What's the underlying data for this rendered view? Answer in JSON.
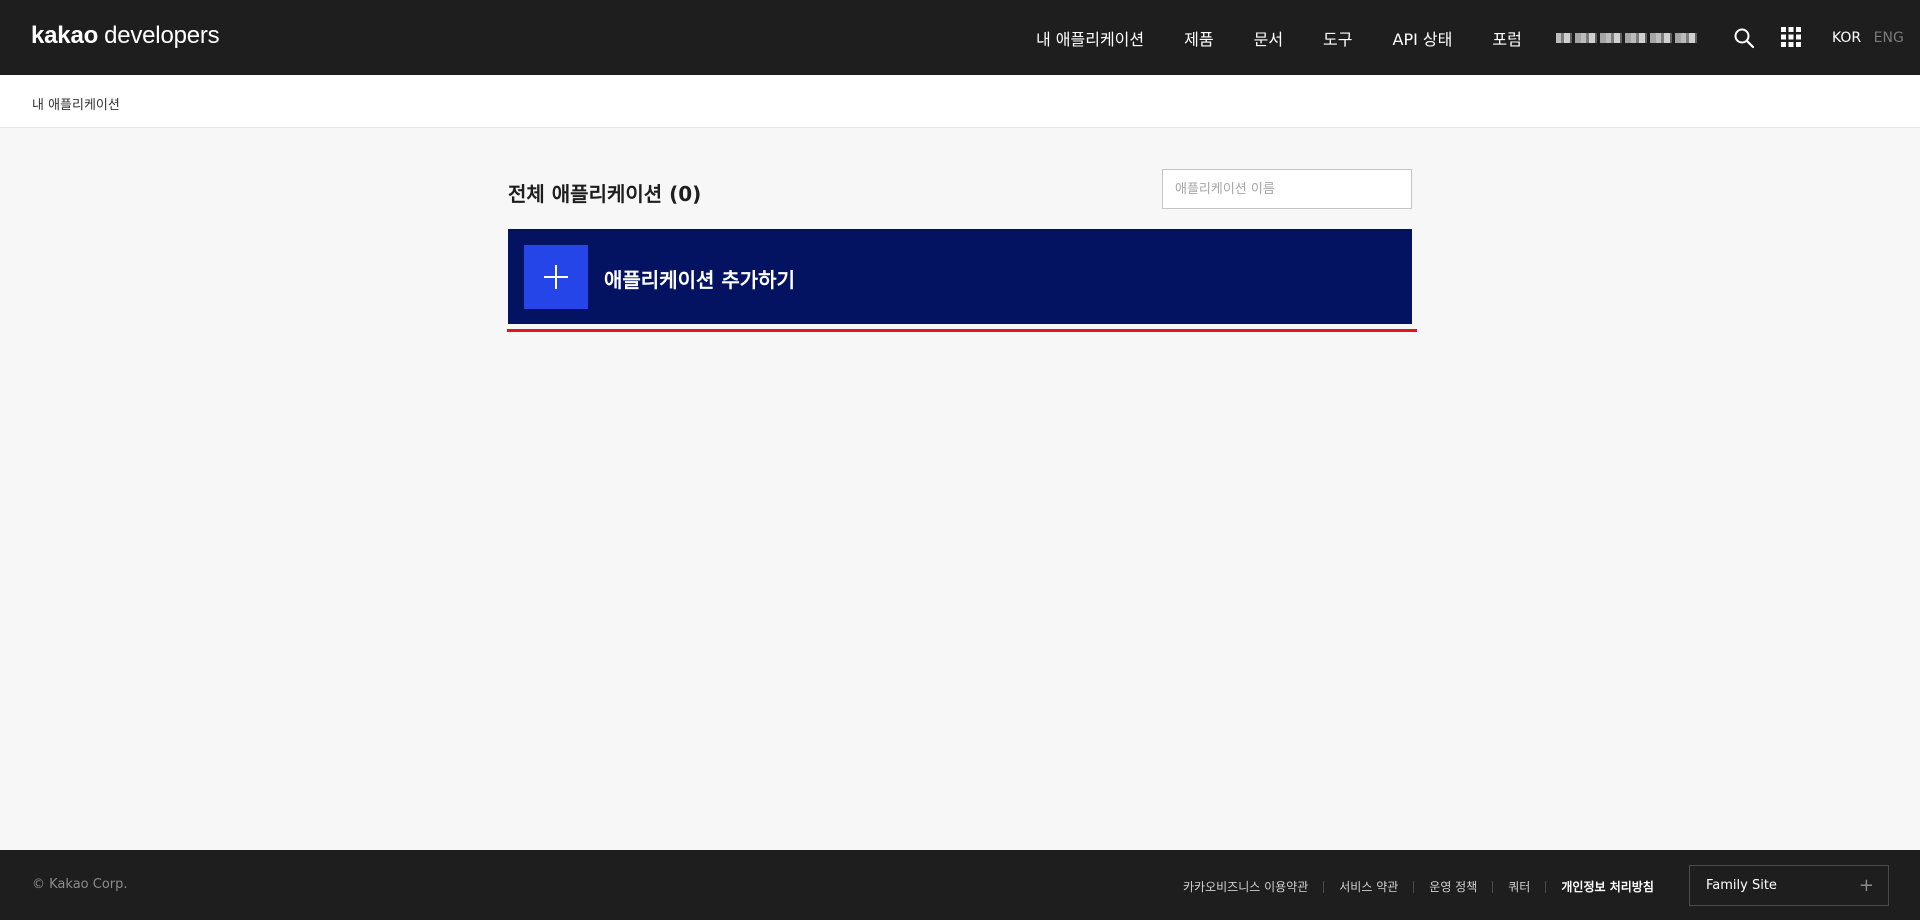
{
  "header": {
    "logo_kakao": "kakao",
    "logo_developers": "developers",
    "nav": [
      {
        "label": "내 애플리케이션"
      },
      {
        "label": "제품"
      },
      {
        "label": "문서"
      },
      {
        "label": "도구"
      },
      {
        "label": "API 상태"
      },
      {
        "label": "포럼"
      }
    ],
    "icons": {
      "search": "search-icon",
      "apps": "apps-grid-icon"
    },
    "lang": {
      "kor": "KOR",
      "eng": "ENG"
    }
  },
  "breadcrumb": {
    "current": "내 애플리케이션"
  },
  "main": {
    "title": "전체 애플리케이션 (0)",
    "search_placeholder": "애플리케이션 이름",
    "add_button_label": "애플리케이션 추가하기"
  },
  "footer": {
    "copyright": "© Kakao Corp.",
    "links": [
      {
        "label": "카카오비즈니스 이용약관"
      },
      {
        "label": "서비스 약관"
      },
      {
        "label": "운영 정책"
      },
      {
        "label": "쿼터"
      },
      {
        "label": "개인정보 처리방침"
      }
    ],
    "family_site": "Family Site"
  },
  "colors": {
    "header_bg": "#1e1e1e",
    "add_button_bg": "#031362",
    "plus_box_bg": "#2545e8",
    "highlight_underline": "#e8131b"
  }
}
